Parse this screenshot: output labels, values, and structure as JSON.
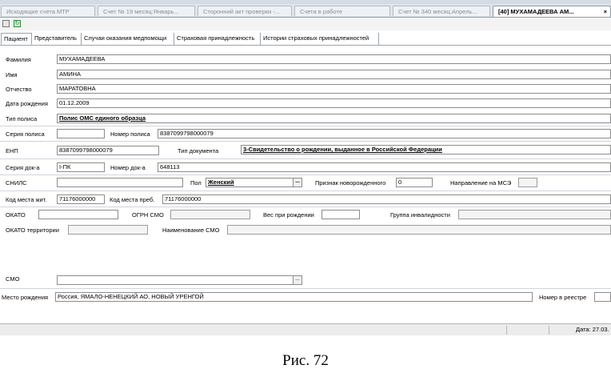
{
  "doc_tabs": [
    {
      "label": "Исходящие счета МТР"
    },
    {
      "label": "Счет № 19 месяц:Январь..."
    },
    {
      "label": "Сторонний акт проверки -..."
    },
    {
      "label": "Счета в работе"
    },
    {
      "label": "Счет № 340 месяц:Апрель..."
    },
    {
      "label": "[40] МУХАМАДЕЕВА АМ...",
      "close": "×"
    }
  ],
  "toolbar": {
    "save_icon": "save-icon",
    "refresh_icon": "refresh-icon",
    "refresh_glyph": "↻"
  },
  "sub_tabs": [
    "Пациент",
    "Представитель",
    "Случаи оказания медпомощи",
    "Страховая принадлежность",
    "Истории страховых принадлежностей"
  ],
  "patient": {
    "last_name_label": "Фамилия",
    "last_name": "МУХАМАДЕЕВА",
    "first_name_label": "Имя",
    "first_name": "АМИНА",
    "patronymic_label": "Отчество",
    "patronymic": "МАРАТОВНА",
    "birth_date_label": "Дата рождения",
    "birth_date": "01.12.2009",
    "policy_type_label": "Тип полиса",
    "policy_type": "Полис ОМС единого образца",
    "policy_series_label": "Серия полиса",
    "policy_series": "",
    "policy_number_label": "Номер полиса",
    "policy_number": "8387099798000079",
    "enp_label": "ЕНП",
    "enp": "8387099798000079",
    "doc_type_label": "Тип документа",
    "doc_type": "3-Свидетельство о рождении, выданное в Российской Федерации",
    "doc_series_label": "Серия док-а",
    "doc_series": "I-ПК",
    "doc_number_label": "Номер док-а",
    "doc_number": "648113",
    "snils_label": "СНИЛС",
    "snils": "",
    "gender_label": "Пол",
    "gender": "Женский",
    "gender_button": "...",
    "newborn_label": "Признак новорожденного",
    "newborn": "0",
    "mse_label": "Направление на МСЭ",
    "mse": "",
    "res_code_label": "Код места жит.",
    "res_code": "71176000000",
    "stay_code_label": "Код места преб.",
    "stay_code": "71176000000",
    "okato_label": "ОКАТО",
    "okato": "",
    "ogrn_label": "ОГРН СМО",
    "ogrn": "",
    "birth_weight_label": "Вес при рождении",
    "birth_weight": "",
    "disability_label": "Группа инвалидности",
    "disability": "",
    "okato_terr_label": "ОКАТО территории",
    "okato_terr": "",
    "smo_name_label": "Наименование СМО",
    "smo_name": "",
    "smo_label": "СМО",
    "smo": "",
    "smo_button": "...",
    "birthplace_label": "Место рождения",
    "birthplace": "Россия, ЯМАЛО-НЕНЕЦКИЙ АО, НОВЫЙ УРЕНГОЙ",
    "registry_number_label": "Номер в реестре",
    "registry_number": ""
  },
  "status": {
    "date": "Дата: 27.03."
  },
  "caption": "Рис. 72"
}
